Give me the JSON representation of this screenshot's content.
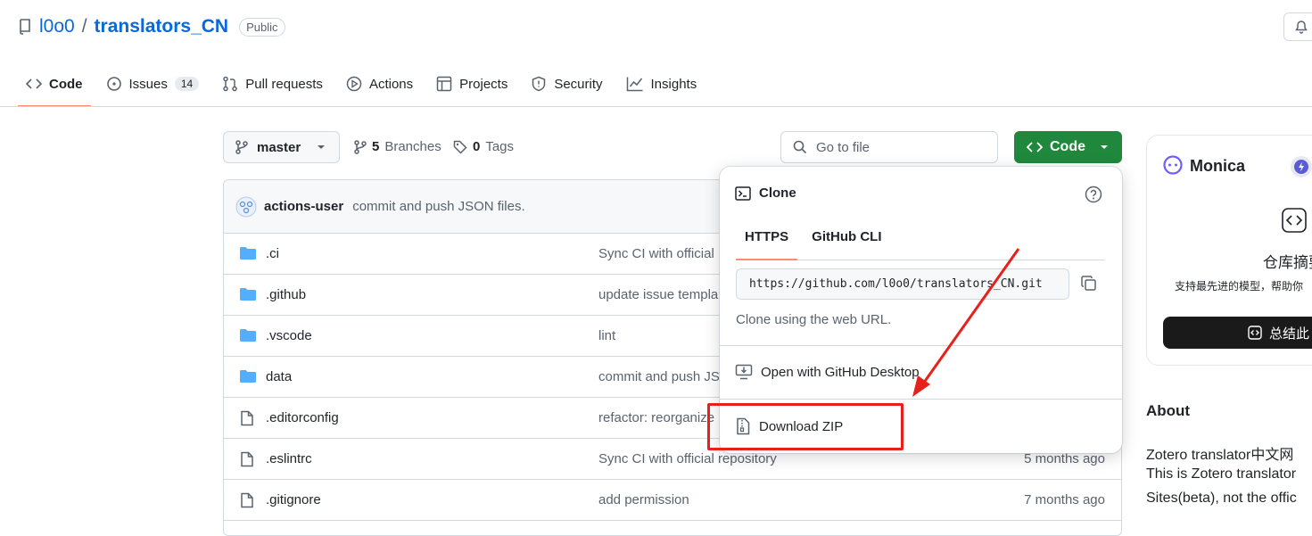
{
  "repo": {
    "owner": "l0o0",
    "separator": "/",
    "name": "translators_CN",
    "visibility": "Public"
  },
  "nav": {
    "tabs": [
      {
        "label": "Code",
        "icon": "code-icon",
        "active": true
      },
      {
        "label": "Issues",
        "icon": "issue-icon",
        "count": "14"
      },
      {
        "label": "Pull requests",
        "icon": "pull-request-icon"
      },
      {
        "label": "Actions",
        "icon": "play-icon"
      },
      {
        "label": "Projects",
        "icon": "table-icon"
      },
      {
        "label": "Security",
        "icon": "shield-icon"
      },
      {
        "label": "Insights",
        "icon": "graph-icon"
      }
    ]
  },
  "toolbar": {
    "branch": "master",
    "branches_count": "5",
    "branches_label": "Branches",
    "tags_count": "0",
    "tags_label": "Tags",
    "goto_placeholder": "Go to file",
    "code_button": "Code"
  },
  "commit": {
    "author": "actions-user",
    "message": "commit and push JSON files."
  },
  "files": [
    {
      "name": ".ci",
      "type": "folder",
      "message": "Sync CI with official",
      "age": ""
    },
    {
      "name": ".github",
      "type": "folder",
      "message": "update issue templa",
      "age": ""
    },
    {
      "name": ".vscode",
      "type": "folder",
      "message": "lint",
      "age": ""
    },
    {
      "name": "data",
      "type": "folder",
      "message": "commit and push JS",
      "age": ""
    },
    {
      "name": ".editorconfig",
      "type": "file",
      "message": "refactor: reorganize",
      "age": ""
    },
    {
      "name": ".eslintrc",
      "type": "file",
      "message": "Sync CI with official repository",
      "age": "5 months ago"
    },
    {
      "name": ".gitignore",
      "type": "file",
      "message": "add permission",
      "age": "7 months ago"
    }
  ],
  "clone_panel": {
    "title": "Clone",
    "tabs": [
      "HTTPS",
      "GitHub CLI"
    ],
    "url": "https://github.com/l0o0/translators_CN.git",
    "hint": "Clone using the web URL.",
    "open_desktop": "Open with GitHub Desktop",
    "download_zip": "Download ZIP"
  },
  "monica": {
    "name": "Monica",
    "title": "仓库摘要",
    "subtitle": "支持最先进的模型，帮助你",
    "button": "总结此"
  },
  "about": {
    "heading": "About",
    "line1": "Zotero translator中文网",
    "line2": "This is Zotero translator",
    "line3": "Sites(beta), not the offic"
  },
  "colors": {
    "accent_green": "#1f883d",
    "link_blue": "#0969da",
    "tab_underline": "#fd8c73",
    "annotation_red": "#e8201b",
    "folder_blue": "#54aeff"
  }
}
